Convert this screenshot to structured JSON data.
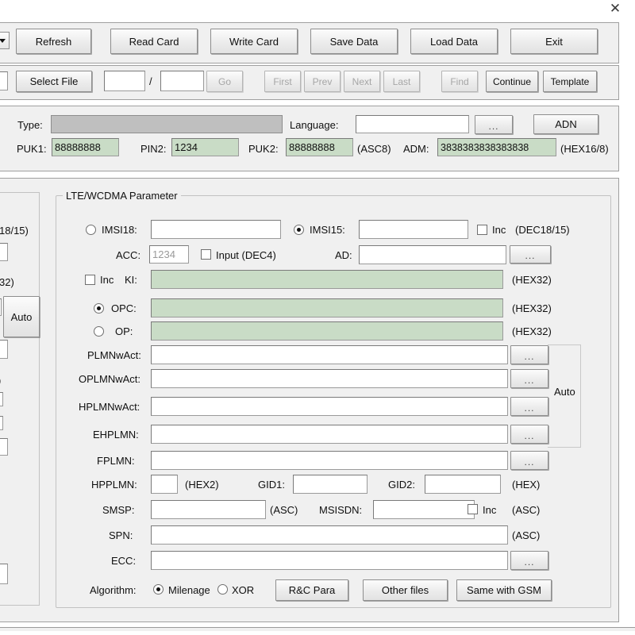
{
  "window": {
    "close_icon": "close-icon",
    "close_glyph": "✕"
  },
  "toolbar": {
    "combo_arrow_icon": "chevron-down-icon",
    "buttons": [
      {
        "label": "Refresh",
        "enabled": true
      },
      {
        "label": "Read Card",
        "enabled": true
      },
      {
        "label": "Write Card",
        "enabled": true
      },
      {
        "label": "Save Data",
        "enabled": true
      },
      {
        "label": "Load Data",
        "enabled": true
      },
      {
        "label": "Exit",
        "enabled": true
      }
    ]
  },
  "navbar": {
    "select_file_label": "Select File",
    "index_value": "",
    "index_placeholder": "",
    "total_value": "",
    "total_placeholder": "",
    "separator": "/",
    "buttons": [
      {
        "label": "Go",
        "enabled": false
      },
      {
        "label": "First",
        "enabled": false
      },
      {
        "label": "Prev",
        "enabled": false
      },
      {
        "label": "Next",
        "enabled": false
      },
      {
        "label": "Last",
        "enabled": false
      },
      {
        "label": "Find",
        "enabled": false
      },
      {
        "label": "Continue",
        "enabled": true
      },
      {
        "label": "Template",
        "enabled": true
      }
    ]
  },
  "card_info": {
    "type_label": "Type:",
    "type_value": "",
    "language_label": "Language:",
    "language_value": "",
    "language_browse_label": "...",
    "adn_label": "ADN",
    "puk1_label": "PUK1:",
    "puk1_value": "88888888",
    "pin2_label": "PIN2:",
    "pin2_value": "1234",
    "puk2_label": "PUK2:",
    "puk2_value": "88888888",
    "puk2_hint": "(ASC8)",
    "adm_label": "ADM:",
    "adm_value": "3838383838383838",
    "adm_hint": "(HEX16/8)"
  },
  "clipped_left": {
    "hint_dec1815": "18/15)",
    "hint_hex32": "32)",
    "auto_label": "Auto"
  },
  "lte": {
    "group_title": "LTE/WCDMA Parameter",
    "imsi18_label": "IMSI18:",
    "imsi18_value": "",
    "imsi18_selected": false,
    "imsi15_label": "IMSI15:",
    "imsi15_value": "",
    "imsi15_selected": true,
    "imsi_inc_label": "Inc",
    "imsi_inc_checked": false,
    "imsi_hint": "(DEC18/15)",
    "acc_label": "ACC:",
    "acc_value": "1234",
    "acc_input_label": "Input (DEC4)",
    "acc_input_checked": false,
    "ad_label": "AD:",
    "ad_value": "",
    "ad_browse_label": "...",
    "ki_inc_label": "Inc",
    "ki_inc_checked": false,
    "ki_label": "KI:",
    "ki_value": "",
    "ki_hint": "(HEX32)",
    "opc_label": "OPC:",
    "opc_value": "",
    "opc_hint": "(HEX32)",
    "opc_selected": true,
    "op_label": "OP:",
    "op_value": "",
    "op_hint": "(HEX32)",
    "op_selected": false,
    "auto_label": "Auto",
    "plmn_rows": [
      {
        "label": "PLMNwAct:",
        "value": "",
        "browse": "..."
      },
      {
        "label": "OPLMNwAct:",
        "value": "",
        "browse": "..."
      },
      {
        "label": "HPLMNwAct:",
        "value": "",
        "browse": "..."
      },
      {
        "label": "EHPLMN:",
        "value": "",
        "browse": "..."
      },
      {
        "label": "FPLMN:",
        "value": "",
        "browse": "..."
      }
    ],
    "hpplmn_label": "HPPLMN:",
    "hpplmn_value": "",
    "hpplmn_hint": "(HEX2)",
    "gid1_label": "GID1:",
    "gid1_value": "",
    "gid2_label": "GID2:",
    "gid2_value": "",
    "gid_hint": "(HEX)",
    "smsp_label": "SMSP:",
    "smsp_value": "",
    "smsp_hint": "(ASC)",
    "msisdn_label": "MSISDN:",
    "msisdn_value": "",
    "msisdn_inc_label": "Inc",
    "msisdn_inc_checked": false,
    "msisdn_hint": "(ASC)",
    "spn_label": "SPN:",
    "spn_value": "",
    "spn_hint": "(ASC)",
    "ecc_label": "ECC:",
    "ecc_value": "",
    "ecc_browse_label": "...",
    "algorithm_label": "Algorithm:",
    "algo_milenage_label": "Milenage",
    "algo_milenage_selected": true,
    "algo_xor_label": "XOR",
    "algo_xor_selected": false,
    "rc_para_label": "R&C Para",
    "other_files_label": "Other files",
    "same_with_gsm_label": "Same with GSM"
  },
  "colors": {
    "panel": "#f0f0f0",
    "field_green": "#c9dcc6",
    "field_grey": "#bfbfbf",
    "border": "#a0a0a0"
  }
}
